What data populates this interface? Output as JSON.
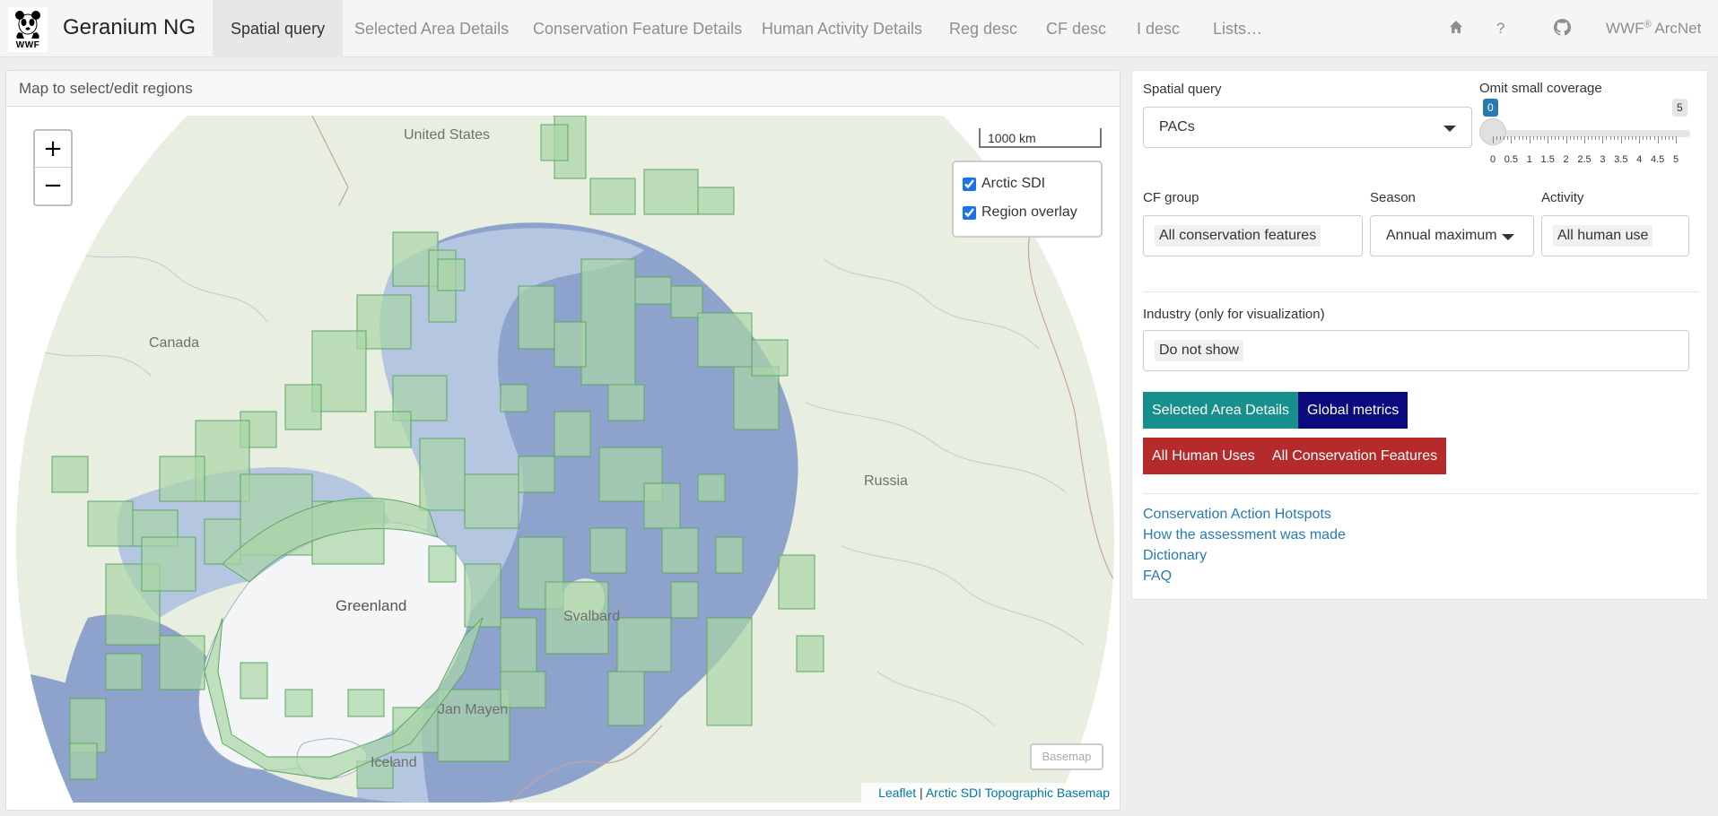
{
  "navbar": {
    "logo_text": "WWF",
    "brand": "Geranium NG",
    "tabs": [
      {
        "label": "Spatial query",
        "active": true
      },
      {
        "label": "Selected Area Details"
      },
      {
        "label": "Conservation Feature Details"
      },
      {
        "label": "Human Activity Details"
      },
      {
        "label": "Reg desc"
      },
      {
        "label": "CF desc"
      },
      {
        "label": "I desc"
      },
      {
        "label": "Lists…"
      }
    ],
    "right": {
      "home_icon": "home-icon",
      "help": "?",
      "github_icon": "github-icon",
      "wwf_prefix": "WWF",
      "wwf_reg": "®",
      "wwf_suffix": " ArcNet"
    }
  },
  "map": {
    "heading": "Map to select/edit regions",
    "zoom_in": "+",
    "zoom_out": "−",
    "scale_label": "1000 km",
    "layers": [
      {
        "label": "Arctic SDI",
        "checked": true
      },
      {
        "label": "Region overlay",
        "checked": true
      }
    ],
    "basemap_button": "Basemap",
    "attribution_leaflet": "Leaflet",
    "attribution_sep": " | ",
    "attribution_source": "Arctic SDI Topographic Basemap",
    "place_labels": {
      "united_states": "United States",
      "canada": "Canada",
      "russia": "Russia",
      "greenland": "Greenland",
      "svalbard": "Svalbard",
      "jan_mayen": "Jan Mayen",
      "iceland": "Iceland"
    },
    "colors": {
      "land": "#e9efe0",
      "ocean_deep": "#8da3cc",
      "ocean_shelf": "#b5c6e0",
      "ice": "#f4f5f6",
      "region_fill": "#a9d6a7",
      "region_stroke": "#5aa763"
    }
  },
  "side": {
    "spatial_query": {
      "label": "Spatial query",
      "value": "PACs"
    },
    "omit_small": {
      "label": "Omit small coverage",
      "min": 0,
      "max": 5,
      "value": 0,
      "min_badge": "0",
      "max_badge": "5",
      "ticks": [
        "0",
        "0.5",
        "1",
        "1.5",
        "2",
        "2.5",
        "3",
        "3.5",
        "4",
        "4.5",
        "5"
      ]
    },
    "cf_group": {
      "label": "CF group",
      "value": "All conservation features"
    },
    "season": {
      "label": "Season",
      "value": "Annual maximum"
    },
    "activity": {
      "label": "Activity",
      "value": "All human use"
    },
    "industry": {
      "label": "Industry (only for visualization)",
      "value": "Do not show"
    },
    "buttons": {
      "selected_area": "Selected Area Details",
      "global_metrics": "Global metrics",
      "all_human_uses": "All Human Uses",
      "all_cf": "All Conservation Features"
    },
    "links": [
      "Conservation Action Hotspots",
      "How the assessment was made",
      "Dictionary",
      "FAQ"
    ],
    "colors": {
      "teal": "#17908d",
      "navy": "#0a0a7e",
      "red": "#b52b2b",
      "slider_badge": "#2a7ab0"
    }
  }
}
